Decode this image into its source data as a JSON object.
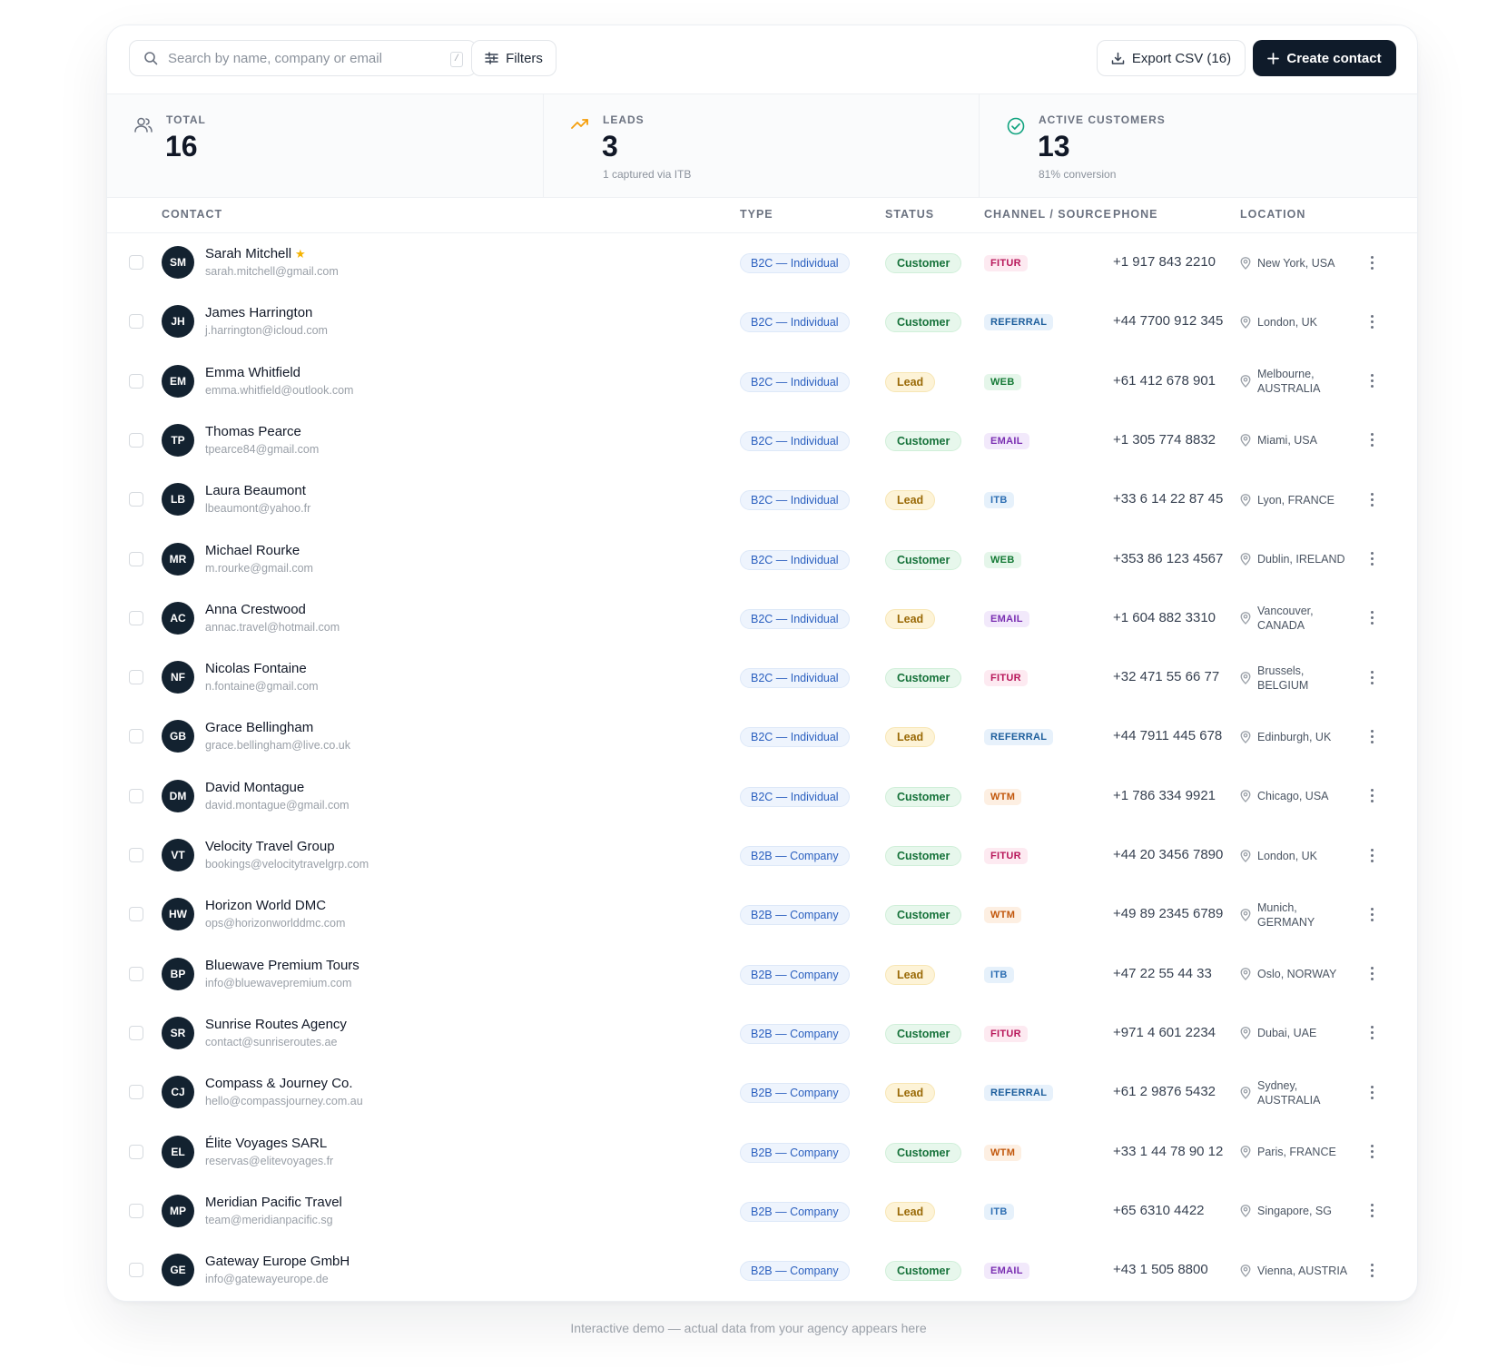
{
  "toolbar": {
    "search_placeholder": "Search by name, company or email",
    "search_shortcut": "/",
    "filters_label": "Filters",
    "export_label": "Export CSV (16)",
    "create_label": "Create contact"
  },
  "stats": [
    {
      "label": "TOTAL",
      "value": "16",
      "sub": "",
      "icon": "users-icon"
    },
    {
      "label": "LEADS",
      "value": "3",
      "sub": "1 captured via ITB",
      "icon": "trending-up-icon"
    },
    {
      "label": "ACTIVE CUSTOMERS",
      "value": "13",
      "sub": "81% conversion",
      "icon": "check-circle-icon"
    }
  ],
  "columns": {
    "contact": "CONTACT",
    "type": "TYPE",
    "status": "STATUS",
    "channel": "CHANNEL / SOURCE",
    "phone": "PHONE",
    "location": "LOCATION"
  },
  "colors": {
    "accent_dark": "#0f1b2a",
    "customer": "#16723a",
    "lead": "#9a6a07",
    "star": "#f5b301"
  },
  "contacts": [
    {
      "initials": "SM",
      "name": "Sarah Mitchell",
      "starred": true,
      "email": "sarah.mitchell@gmail.com",
      "type": "B2C — Individual",
      "status": "Customer",
      "channel": "FITUR",
      "phone": "+1 917 843 2210",
      "location": "New York, USA"
    },
    {
      "initials": "JH",
      "name": "James Harrington",
      "starred": false,
      "email": "j.harrington@icloud.com",
      "type": "B2C — Individual",
      "status": "Customer",
      "channel": "REFERRAL",
      "phone": "+44 7700 912 345",
      "location": "London, UK"
    },
    {
      "initials": "EM",
      "name": "Emma Whitfield",
      "starred": false,
      "email": "emma.whitfield@outlook.com",
      "type": "B2C — Individual",
      "status": "Lead",
      "channel": "WEB",
      "phone": "+61 412 678 901",
      "location": "Melbourne, AUSTRALIA"
    },
    {
      "initials": "TP",
      "name": "Thomas Pearce",
      "starred": false,
      "email": "tpearce84@gmail.com",
      "type": "B2C — Individual",
      "status": "Customer",
      "channel": "EMAIL",
      "phone": "+1 305 774 8832",
      "location": "Miami, USA"
    },
    {
      "initials": "LB",
      "name": "Laura Beaumont",
      "starred": false,
      "email": "lbeaumont@yahoo.fr",
      "type": "B2C — Individual",
      "status": "Lead",
      "channel": "ITB",
      "phone": "+33 6 14 22 87 45",
      "location": "Lyon, FRANCE"
    },
    {
      "initials": "MR",
      "name": "Michael Rourke",
      "starred": false,
      "email": "m.rourke@gmail.com",
      "type": "B2C — Individual",
      "status": "Customer",
      "channel": "WEB",
      "phone": "+353 86 123 4567",
      "location": "Dublin, IRELAND"
    },
    {
      "initials": "AC",
      "name": "Anna Crestwood",
      "starred": false,
      "email": "annac.travel@hotmail.com",
      "type": "B2C — Individual",
      "status": "Lead",
      "channel": "EMAIL",
      "phone": "+1 604 882 3310",
      "location": "Vancouver, CANADA"
    },
    {
      "initials": "NF",
      "name": "Nicolas Fontaine",
      "starred": false,
      "email": "n.fontaine@gmail.com",
      "type": "B2C — Individual",
      "status": "Customer",
      "channel": "FITUR",
      "phone": "+32 471 55 66 77",
      "location": "Brussels, BELGIUM"
    },
    {
      "initials": "GB",
      "name": "Grace Bellingham",
      "starred": false,
      "email": "grace.bellingham@live.co.uk",
      "type": "B2C — Individual",
      "status": "Lead",
      "channel": "REFERRAL",
      "phone": "+44 7911 445 678",
      "location": "Edinburgh, UK"
    },
    {
      "initials": "DM",
      "name": "David Montague",
      "starred": false,
      "email": "david.montague@gmail.com",
      "type": "B2C — Individual",
      "status": "Customer",
      "channel": "WTM",
      "phone": "+1 786 334 9921",
      "location": "Chicago, USA"
    },
    {
      "initials": "VT",
      "name": "Velocity Travel Group",
      "starred": false,
      "email": "bookings@velocitytravelgrp.com",
      "type": "B2B — Company",
      "status": "Customer",
      "channel": "FITUR",
      "phone": "+44 20 3456 7890",
      "location": "London, UK"
    },
    {
      "initials": "HW",
      "name": "Horizon World DMC",
      "starred": false,
      "email": "ops@horizonworlddmc.com",
      "type": "B2B — Company",
      "status": "Customer",
      "channel": "WTM",
      "phone": "+49 89 2345 6789",
      "location": "Munich, GERMANY"
    },
    {
      "initials": "BP",
      "name": "Bluewave Premium Tours",
      "starred": false,
      "email": "info@bluewavepremium.com",
      "type": "B2B — Company",
      "status": "Lead",
      "channel": "ITB",
      "phone": "+47 22 55 44 33",
      "location": "Oslo, NORWAY"
    },
    {
      "initials": "SR",
      "name": "Sunrise Routes Agency",
      "starred": false,
      "email": "contact@sunriseroutes.ae",
      "type": "B2B — Company",
      "status": "Customer",
      "channel": "FITUR",
      "phone": "+971 4 601 2234",
      "location": "Dubai, UAE"
    },
    {
      "initials": "CJ",
      "name": "Compass & Journey Co.",
      "starred": false,
      "email": "hello@compassjourney.com.au",
      "type": "B2B — Company",
      "status": "Lead",
      "channel": "REFERRAL",
      "phone": "+61 2 9876 5432",
      "location": "Sydney, AUSTRALIA"
    },
    {
      "initials": "EL",
      "name": "Élite Voyages SARL",
      "starred": false,
      "email": "reservas@elitevoyages.fr",
      "type": "B2B — Company",
      "status": "Customer",
      "channel": "WTM",
      "phone": "+33 1 44 78 90 12",
      "location": "Paris, FRANCE"
    },
    {
      "initials": "MP",
      "name": "Meridian Pacific Travel",
      "starred": false,
      "email": "team@meridianpacific.sg",
      "type": "B2B — Company",
      "status": "Lead",
      "channel": "ITB",
      "phone": "+65 6310 4422",
      "location": "Singapore, SG"
    },
    {
      "initials": "GE",
      "name": "Gateway Europe GmbH",
      "starred": false,
      "email": "info@gatewayeurope.de",
      "type": "B2B — Company",
      "status": "Customer",
      "channel": "EMAIL",
      "phone": "+43 1 505 8800",
      "location": "Vienna, AUSTRIA"
    }
  ],
  "footer_text": "Interactive demo — actual data from your agency appears here"
}
